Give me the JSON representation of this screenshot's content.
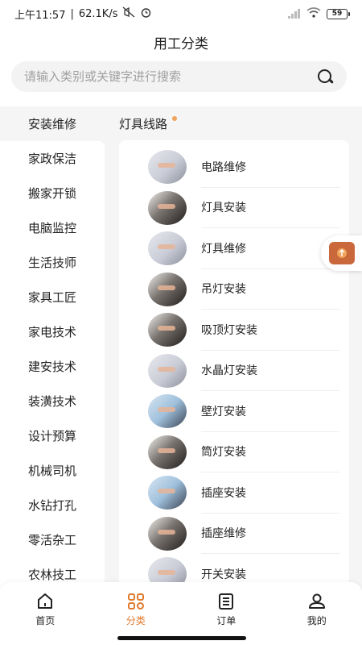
{
  "status": {
    "time": "上午11:57",
    "speed": "62.1K/s",
    "battery": "59"
  },
  "header": {
    "title": "用工分类"
  },
  "search": {
    "placeholder": "请输入类别或关键字进行搜索"
  },
  "sidebar": {
    "items": [
      {
        "label": "安装维修",
        "active": true
      },
      {
        "label": "家政保洁"
      },
      {
        "label": "搬家开锁"
      },
      {
        "label": "电脑监控"
      },
      {
        "label": "生活技师"
      },
      {
        "label": "家具工匠"
      },
      {
        "label": "家电技术"
      },
      {
        "label": "建安技术"
      },
      {
        "label": "装潢技术"
      },
      {
        "label": "设计预算"
      },
      {
        "label": "机械司机"
      },
      {
        "label": "水钻打孔"
      },
      {
        "label": "零活杂工"
      },
      {
        "label": "农林技工"
      }
    ]
  },
  "content": {
    "section_title": "灯具线路",
    "items": [
      {
        "label": "电路维修",
        "icon": "electrician-photo"
      },
      {
        "label": "灯具安装",
        "icon": "lamp-install-photo"
      },
      {
        "label": "灯具维修",
        "icon": "lamp-repair-photo"
      },
      {
        "label": "吊灯安装",
        "icon": "chandelier-photo"
      },
      {
        "label": "吸顶灯安装",
        "icon": "ceiling-lamp-photo"
      },
      {
        "label": "水晶灯安装",
        "icon": "crystal-lamp-photo"
      },
      {
        "label": "壁灯安装",
        "icon": "wall-lamp-photo"
      },
      {
        "label": "筒灯安装",
        "icon": "downlight-photo"
      },
      {
        "label": "插座安装",
        "icon": "socket-install-photo"
      },
      {
        "label": "插座维修",
        "icon": "socket-repair-photo"
      },
      {
        "label": "开关安装",
        "icon": "switch-install-photo"
      }
    ]
  },
  "tabbar": {
    "items": [
      {
        "label": "首页",
        "icon": "home-icon"
      },
      {
        "label": "分类",
        "icon": "category-icon",
        "active": true
      },
      {
        "label": "订单",
        "icon": "order-icon"
      },
      {
        "label": "我的",
        "icon": "profile-icon"
      }
    ]
  },
  "colors": {
    "accent": "#e07a2c",
    "float_button": "#c9683b",
    "dot": "#f0a35b"
  }
}
